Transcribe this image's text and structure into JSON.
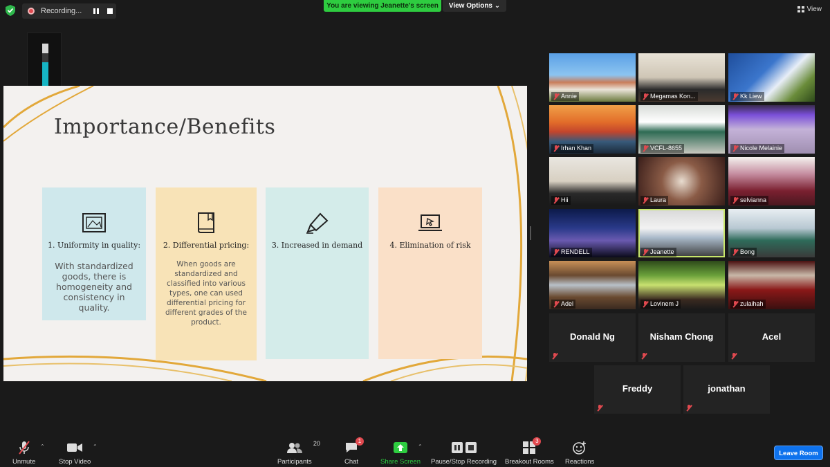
{
  "topbar": {
    "recording_label": "Recording...",
    "viewing_banner": "You are viewing Jeanette's screen",
    "view_options": "View Options",
    "view_label": "View"
  },
  "audio_meter": {
    "value": "66",
    "level": 0.56
  },
  "slide": {
    "title": "Importance/Benefits",
    "cards": [
      {
        "heading": "1. Uniformity in quality:",
        "body": "With standardized goods, there is homogeneity and consistency in quality.",
        "icon": "framed-picture-icon",
        "color": "#cfe8ec"
      },
      {
        "heading": "2. Differential pricing:",
        "body": "When goods are standardized and classified into various types, one can used differential pricing for different grades of the product.",
        "icon": "book-icon",
        "color": "#f8e3b7"
      },
      {
        "heading": "3. Increased in demand",
        "body": "",
        "icon": "highlighter-icon",
        "color": "#d4ecea"
      },
      {
        "heading": "4. Elimination of risk",
        "body": "",
        "icon": "laptop-cursor-icon",
        "color": "#fae0c8"
      }
    ]
  },
  "participants_gallery": [
    {
      "name": "Annie"
    },
    {
      "name": "Megamas Kon..."
    },
    {
      "name": "Kk Liew"
    },
    {
      "name": "Irhan Khan"
    },
    {
      "name": "VCFL-8655"
    },
    {
      "name": "Nicole Melainie"
    },
    {
      "name": "Hii"
    },
    {
      "name": "Laura"
    },
    {
      "name": "selvianna"
    },
    {
      "name": "RENDELL"
    },
    {
      "name": "Jeanette"
    },
    {
      "name": "Bong"
    },
    {
      "name": "Adel"
    },
    {
      "name": "Lovinem J"
    },
    {
      "name": "zulaihah"
    }
  ],
  "name_only_tiles": [
    {
      "name": "Donald Ng"
    },
    {
      "name": "Nisham Chong"
    },
    {
      "name": "Acel"
    },
    {
      "name": "Freddy"
    },
    {
      "name": "jonathan"
    }
  ],
  "toolbar": {
    "unmute": "Unmute",
    "stop_video": "Stop Video",
    "participants": "Participants",
    "participants_count": "20",
    "chat": "Chat",
    "chat_badge": "1",
    "share_screen": "Share Screen",
    "pause_stop_recording": "Pause/Stop Recording",
    "breakout_rooms": "Breakout Rooms",
    "breakout_badge": "3",
    "reactions": "Reactions",
    "leave_room": "Leave Room"
  },
  "colors": {
    "share_green": "#2ecc40",
    "leave_blue": "#0e72ed",
    "alert_red": "#e0494f",
    "active_speaker": "#c8e66b"
  }
}
